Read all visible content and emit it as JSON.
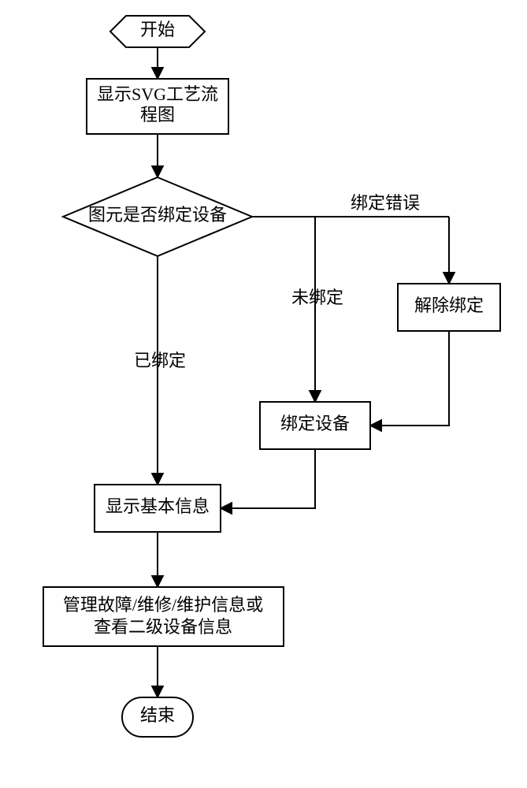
{
  "nodes": {
    "start": "开始",
    "showSvg1": "显示SVG工艺流",
    "showSvg2": "程图",
    "decision": "图元是否绑定设备",
    "unbind": "解除绑定",
    "bindDev": "绑定设备",
    "showInfo": "显示基本信息",
    "manage1": "管理故障/维修/维护信息或",
    "manage2": "查看二级设备信息",
    "end": "结束"
  },
  "edges": {
    "bound": "已绑定",
    "unbound": "未绑定",
    "error": "绑定错误"
  }
}
